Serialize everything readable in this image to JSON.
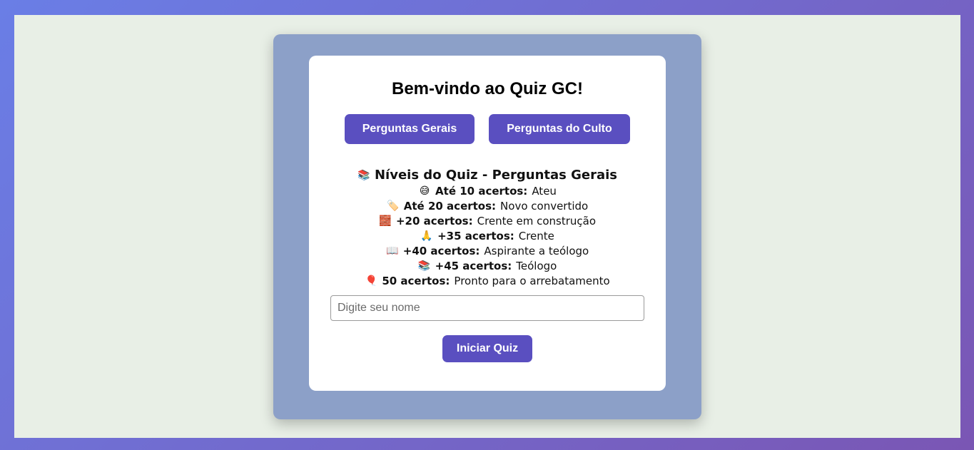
{
  "page": {
    "title": "Bem-vindo ao Quiz GC!",
    "buttons": {
      "gerais": "Perguntas Gerais",
      "culto": "Perguntas do Culto",
      "start": "Iniciar Quiz"
    },
    "input": {
      "placeholder": "Digite seu nome",
      "value": ""
    }
  },
  "levels": {
    "heading_emoji": "📚",
    "heading": "Níveis do Quiz - Perguntas Gerais",
    "items": [
      {
        "emoji": "😅",
        "label": "Até 10 acertos:",
        "desc": "Ateu"
      },
      {
        "emoji": "🏷️",
        "label": "Até 20 acertos:",
        "desc": "Novo convertido"
      },
      {
        "emoji": "🧱",
        "label": "+20 acertos:",
        "desc": "Crente em construção"
      },
      {
        "emoji": "🙏",
        "label": "+35 acertos:",
        "desc": "Crente"
      },
      {
        "emoji": "📖",
        "label": "+40 acertos:",
        "desc": "Aspirante a teólogo"
      },
      {
        "emoji": "📚",
        "label": "+45 acertos:",
        "desc": "Teólogo"
      },
      {
        "emoji": "🎈",
        "label": "50 acertos:",
        "desc": "Pronto para o arrebatamento"
      }
    ]
  },
  "colors": {
    "accent": "#5a4fc0",
    "outer_card": "#8ca0c8",
    "page_background": "#e8efe6"
  }
}
